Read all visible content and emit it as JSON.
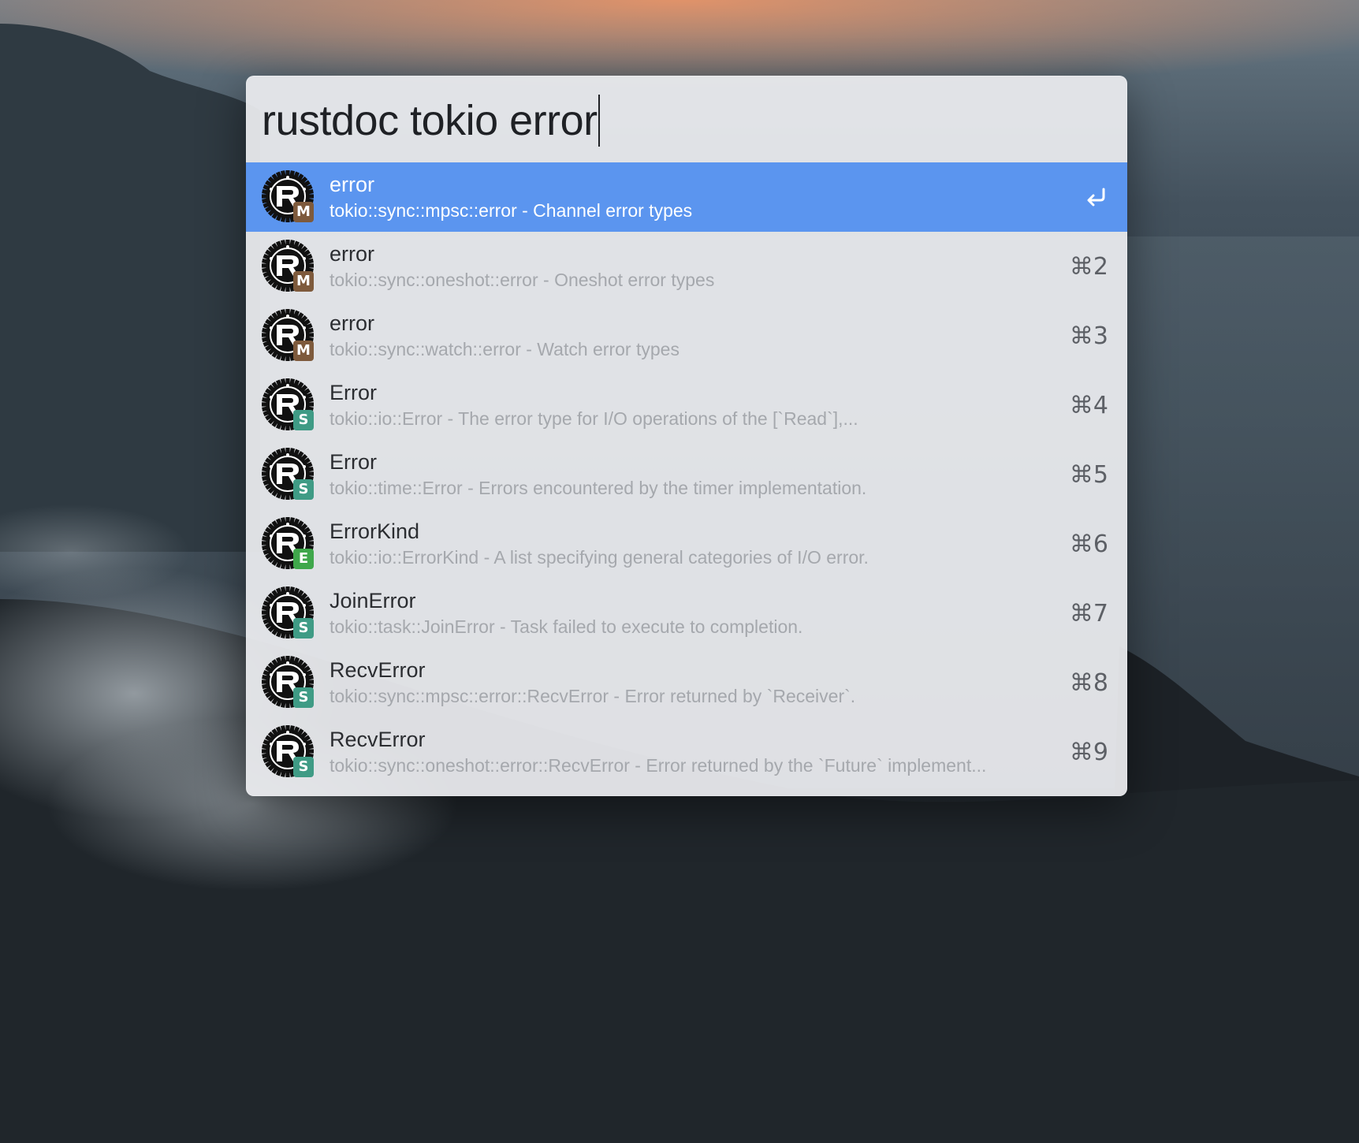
{
  "search": {
    "query": "rustdoc tokio error"
  },
  "colors": {
    "selected_row": "#5b95ef",
    "badge_module": "#7e5a3c",
    "badge_struct": "#3f9b85",
    "badge_enum": "#3fa74b"
  },
  "results": [
    {
      "title": "error",
      "subtitle": "tokio::sync::mpsc::error - Channel error types",
      "badge": "M",
      "badge_kind": "module",
      "shortcut": "",
      "action_icon": "return-icon",
      "selected": true
    },
    {
      "title": "error",
      "subtitle": "tokio::sync::oneshot::error - Oneshot error types",
      "badge": "M",
      "badge_kind": "module",
      "shortcut": "⌘2",
      "selected": false
    },
    {
      "title": "error",
      "subtitle": "tokio::sync::watch::error - Watch error types",
      "badge": "M",
      "badge_kind": "module",
      "shortcut": "⌘3",
      "selected": false
    },
    {
      "title": "Error",
      "subtitle": "tokio::io::Error - The error type for I/O operations of the [`Read`],...",
      "badge": "S",
      "badge_kind": "struct",
      "shortcut": "⌘4",
      "selected": false
    },
    {
      "title": "Error",
      "subtitle": "tokio::time::Error - Errors encountered by the timer implementation.",
      "badge": "S",
      "badge_kind": "struct",
      "shortcut": "⌘5",
      "selected": false
    },
    {
      "title": "ErrorKind",
      "subtitle": "tokio::io::ErrorKind - A list specifying general categories of I/O error.",
      "badge": "E",
      "badge_kind": "enum",
      "shortcut": "⌘6",
      "selected": false
    },
    {
      "title": "JoinError",
      "subtitle": "tokio::task::JoinError - Task failed to execute to completion.",
      "badge": "S",
      "badge_kind": "struct",
      "shortcut": "⌘7",
      "selected": false
    },
    {
      "title": "RecvError",
      "subtitle": "tokio::sync::mpsc::error::RecvError - Error returned by `Receiver`.",
      "badge": "S",
      "badge_kind": "struct",
      "shortcut": "⌘8",
      "selected": false
    },
    {
      "title": "RecvError",
      "subtitle": "tokio::sync::oneshot::error::RecvError - Error returned by the `Future` implement...",
      "badge": "S",
      "badge_kind": "struct",
      "shortcut": "⌘9",
      "selected": false
    }
  ]
}
